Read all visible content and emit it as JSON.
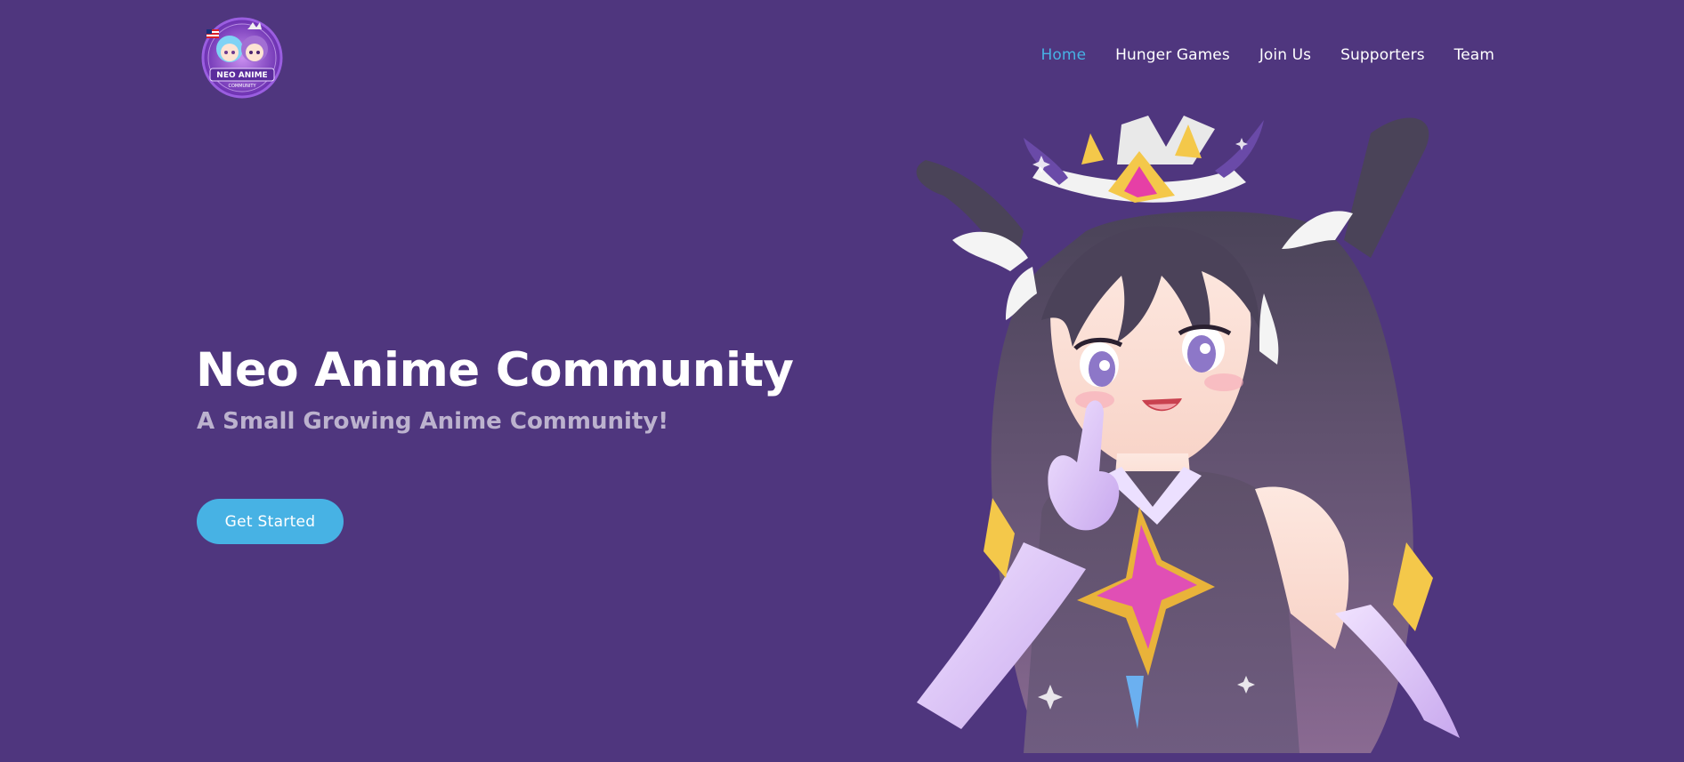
{
  "header": {
    "logo": {
      "label": "NEO ANIME",
      "sublabel": "COMMUNITY",
      "icon": "community-logo-icon"
    },
    "nav": [
      {
        "label": "Home",
        "active": true
      },
      {
        "label": "Hunger Games",
        "active": false
      },
      {
        "label": "Join Us",
        "active": false
      },
      {
        "label": "Supporters",
        "active": false
      },
      {
        "label": "Team",
        "active": false
      }
    ]
  },
  "hero": {
    "title": "Neo Anime Community",
    "subtitle": "A Small Growing Anime Community!",
    "cta_label": "Get Started",
    "illustration": "anime-girl-illustration"
  },
  "colors": {
    "background": "#4f367e",
    "accent": "#47b2e4",
    "text": "#ffffff"
  }
}
